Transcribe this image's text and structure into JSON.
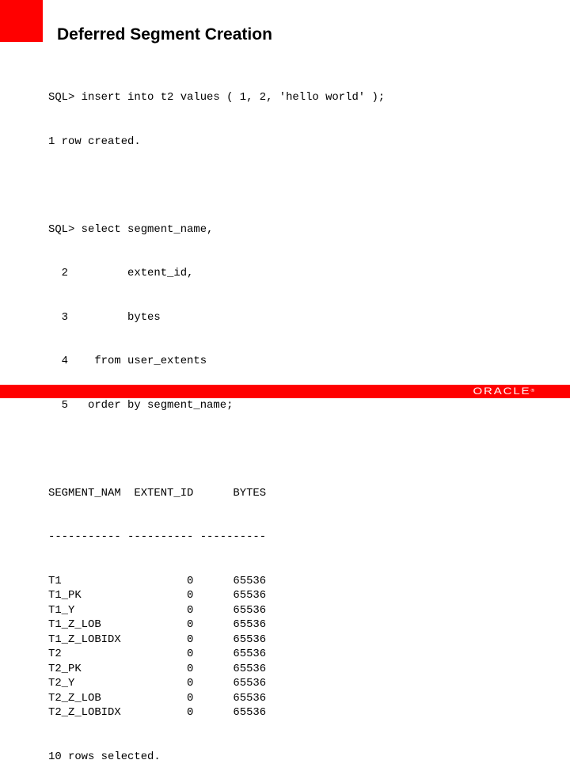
{
  "slide": {
    "title": "Deferred Segment Creation",
    "brand_color": "#ff0000"
  },
  "console": {
    "insert_statement": "SQL> insert into t2 values ( 1, 2, 'hello world' );",
    "insert_result": "1 row created.",
    "query_lines": [
      "SQL> select segment_name,",
      "  2         extent_id,",
      "  3         bytes",
      "  4    from user_extents",
      "  5   order by segment_name;"
    ],
    "result_header": "SEGMENT_NAM  EXTENT_ID      BYTES",
    "result_separator": "----------- ---------- ----------",
    "columns": [
      "SEGMENT_NAM",
      "EXTENT_ID",
      "BYTES"
    ],
    "rows": [
      {
        "segment_name": "T1",
        "extent_id": "0",
        "bytes": "65536"
      },
      {
        "segment_name": "T1_PK",
        "extent_id": "0",
        "bytes": "65536"
      },
      {
        "segment_name": "T1_Y",
        "extent_id": "0",
        "bytes": "65536"
      },
      {
        "segment_name": "T1_Z_LOB",
        "extent_id": "0",
        "bytes": "65536"
      },
      {
        "segment_name": "T1_Z_LOBIDX",
        "extent_id": "0",
        "bytes": "65536"
      },
      {
        "segment_name": "T2",
        "extent_id": "0",
        "bytes": "65536"
      },
      {
        "segment_name": "T2_PK",
        "extent_id": "0",
        "bytes": "65536"
      },
      {
        "segment_name": "T2_Y",
        "extent_id": "0",
        "bytes": "65536"
      },
      {
        "segment_name": "T2_Z_LOB",
        "extent_id": "0",
        "bytes": "65536"
      },
      {
        "segment_name": "T2_Z_LOBIDX",
        "extent_id": "0",
        "bytes": "65536"
      }
    ],
    "row_count_message": "10 rows selected."
  },
  "footer": {
    "logo_text": "ORACLE",
    "logo_mark": "®"
  }
}
